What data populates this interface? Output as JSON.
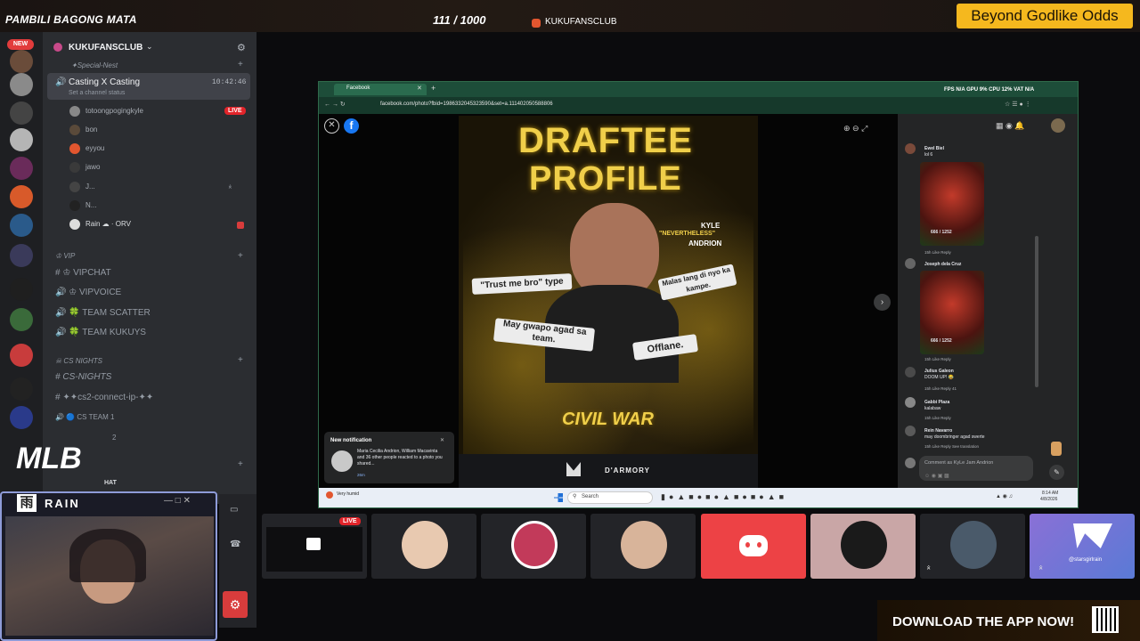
{
  "overlay": {
    "top_left_text": "PAMBILI BAGONG MATA",
    "top_mid_text": "111 / 1000",
    "top_server": "KUKUFANSCLUB",
    "promo": "Beyond Godlike Odds",
    "download": "DOWNLOAD THE APP NOW!"
  },
  "discord": {
    "new_badge": "NEW",
    "server_name": "KUKUFANSCLUB",
    "category_special": "✦Special-Nest",
    "voice_channel": "Casting X Casting",
    "voice_time": "10:42:46",
    "channel_status": "Set a channel status",
    "users": [
      {
        "name": "totoongpogingkyle",
        "live": "LIVE"
      },
      {
        "name": "bon"
      },
      {
        "name": "eyyou"
      },
      {
        "name": "jawo"
      },
      {
        "name": "J..."
      },
      {
        "name": "N..."
      },
      {
        "name": "Rain ☁ · ORV"
      }
    ],
    "category_vip": "VIP",
    "channels_vip": [
      "VIPCHAT",
      "VIPVOICE",
      "TEAM SCATTER",
      "TEAM KUKUYS"
    ],
    "category_cs": "CS NIGHTS",
    "channels_cs": [
      "CS-NIGHTS",
      "✦✦cs2-connect-ip-✦✦",
      "CS TEAM 1",
      "2"
    ],
    "hat": "HAT",
    "mlb_logo": "MLB"
  },
  "cam": {
    "brand": "RAIN"
  },
  "browser": {
    "tab_title": "Facebook",
    "url": "facebook.com/photo?fbid=1986332045323590&set=a.111402050588806",
    "stats": "FPS N/A  GPU 9%  CPU 12%  VAT N/A"
  },
  "poster": {
    "title1": "DRAFTEE",
    "title2": "PROFILE",
    "name_top": "KYLE",
    "name_mid": "\"NEVERTHELESS\"",
    "name_bot": "ANDRION",
    "bubble1": "\"Trust me bro\" type",
    "bubble2": "Malas lang di nyo ka kampe.",
    "bubble3": "May gwapo agad sa team.",
    "bubble4": "Offlane.",
    "event": "CIVIL WAR",
    "sponsor": "D'ARMORY"
  },
  "notification": {
    "title": "New notification",
    "body": "Maria Cecilia Andrion, William Macavinta and 36 other people reacted to a photo you shared...",
    "time": "26m"
  },
  "comments": [
    {
      "name": "Ewel Biel",
      "text": "lol 6",
      "meta": "15h   Like   Reply",
      "img_caption": "666 / 1252"
    },
    {
      "name": "Joseph dela Cruz",
      "text": "",
      "meta": "15h   Like   Reply",
      "img_caption": "666 / 1252"
    },
    {
      "name": "Julius Galeon",
      "text": "DOOM UP! 😂",
      "meta": "15h   Like   Reply   41"
    },
    {
      "name": "Gabbi Plaza",
      "text": "kalabaw",
      "meta": "15h   Like   Reply"
    },
    {
      "name": "Rein Navarro",
      "text": "may doombringer agad swerte",
      "meta": "15h   Like   Reply   See translation"
    }
  ],
  "comment_placeholder": "Comment as KyLe Jam Andrion",
  "taskbar": {
    "search": "Search",
    "weather": "Very humid",
    "time": "8:14 AM",
    "date": "4/8/2026"
  },
  "tiles": {
    "live_badge": "LIVE",
    "rain_tag": "@starsgirlrain"
  }
}
